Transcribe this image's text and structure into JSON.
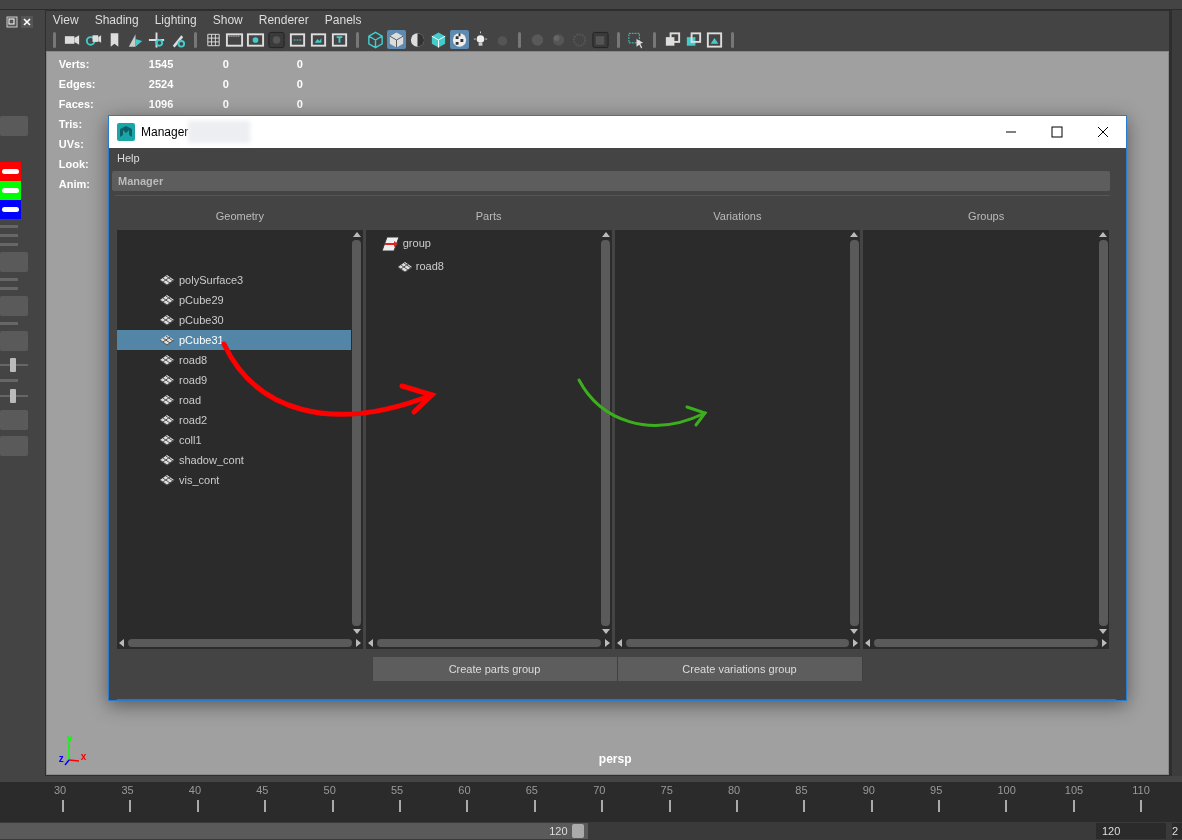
{
  "panel_menu": [
    "View",
    "Shading",
    "Lighting",
    "Show",
    "Renderer",
    "Panels"
  ],
  "toolbar_groups": [
    [
      {
        "selected": false
      },
      {
        "selected": false
      },
      {
        "selected": false
      },
      {
        "selected": false
      },
      {
        "selected": false
      },
      {
        "selected": false
      }
    ],
    [
      {
        "selected": false
      },
      {
        "selected": false
      },
      {
        "selected": false
      },
      {
        "selected": false
      },
      {
        "selected": false
      },
      {
        "selected": false
      },
      {
        "selected": false
      }
    ],
    [
      {
        "selected": false
      },
      {
        "selected": true
      },
      {
        "selected": false
      },
      {
        "selected": false
      },
      {
        "selected": true
      },
      {
        "selected": false
      },
      {
        "selected": false
      }
    ],
    [
      {
        "selected": false
      },
      {
        "selected": false
      },
      {
        "selected": false
      },
      {
        "selected": false
      }
    ],
    [
      {
        "selected": false
      }
    ],
    [
      {
        "selected": false
      },
      {
        "selected": false
      },
      {
        "selected": false
      }
    ]
  ],
  "stats": [
    {
      "label": "Verts:",
      "values": [
        "1545",
        "0",
        "0"
      ]
    },
    {
      "label": "Edges:",
      "values": [
        "2524",
        "0",
        "0"
      ]
    },
    {
      "label": "Faces:",
      "values": [
        "1096",
        "0",
        "0"
      ]
    },
    {
      "label": "Tris:"
    },
    {
      "label": "UVs:"
    },
    {
      "label": "Look:"
    },
    {
      "label": "Anim:"
    }
  ],
  "viewport": {
    "camera": "persp",
    "axes": [
      "y",
      "z",
      "x"
    ]
  },
  "swatches": [
    {
      "color": "#ff0000"
    },
    {
      "color": "#00ff00"
    },
    {
      "color": "#0000ff"
    }
  ],
  "dialog": {
    "title": "Manager",
    "menu": [
      "Help"
    ],
    "section": "Manager",
    "columns": [
      {
        "heading": "Geometry",
        "items": [
          {
            "label": "polySurface3",
            "selected": false
          },
          {
            "label": "pCube29",
            "selected": false
          },
          {
            "label": "pCube30",
            "selected": false
          },
          {
            "label": "pCube31",
            "selected": true
          },
          {
            "label": "road8",
            "selected": false
          },
          {
            "label": "road9",
            "selected": false
          },
          {
            "label": "road",
            "selected": false
          },
          {
            "label": "road2",
            "selected": false
          },
          {
            "label": "coll1",
            "selected": false
          },
          {
            "label": "shadow_cont",
            "selected": false
          },
          {
            "label": "vis_cont",
            "selected": false
          }
        ]
      },
      {
        "heading": "Parts",
        "tree": [
          {
            "label": "group",
            "kind": "group",
            "children": [
              {
                "label": "road8",
                "kind": "mesh"
              }
            ]
          }
        ]
      },
      {
        "heading": "Variations"
      },
      {
        "heading": "Groups"
      }
    ],
    "buttons": [
      "Create parts group",
      "Create variations group"
    ]
  },
  "timeline": {
    "ticks": [
      "30",
      "35",
      "40",
      "45",
      "50",
      "55",
      "60",
      "65",
      "70",
      "75",
      "80",
      "85",
      "90",
      "95",
      "100",
      "105",
      "110"
    ]
  },
  "range": {
    "level": 0.54,
    "end": "120",
    "end_field": "120",
    "next_field": "2"
  }
}
